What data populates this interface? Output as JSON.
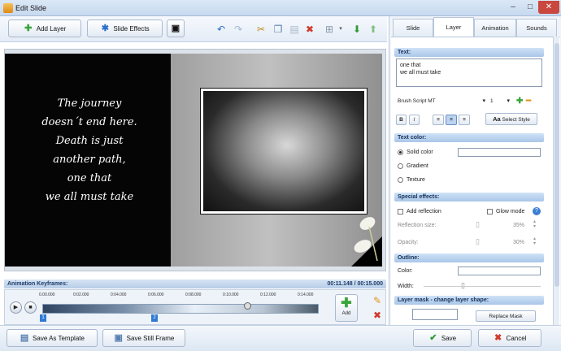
{
  "window": {
    "title": "Edit Slide",
    "controls": [
      "–",
      "□",
      "✕"
    ]
  },
  "toolbar": {
    "add_layer": "Add Layer",
    "slide_effects": "Slide Effects",
    "icons": [
      "preview-icon",
      "undo-icon",
      "redo-icon",
      "cut-icon",
      "copy-icon",
      "paste-icon",
      "delete-icon",
      "align-icon",
      "move-down-icon",
      "move-up-icon"
    ]
  },
  "canvas": {
    "verse_lines": [
      "The journey",
      "doesn´t end here.",
      "Death is just",
      "another path,",
      "one that",
      "we all must take"
    ]
  },
  "keyframes": {
    "label": "Animation Keyframes:",
    "time": "00:11.148 / 00:15.000",
    "ticks": [
      "0.00.000",
      "0:02.000",
      "0:04.000",
      "0:06.000",
      "0:08.000",
      "0:10.000",
      "0:12.000",
      "0:14.000"
    ],
    "markers": [
      "1",
      "2"
    ],
    "position_fraction": 0.74,
    "add_label": "Add"
  },
  "bottom": {
    "save_template": "Save As Template",
    "save_still": "Save Still Frame",
    "save": "Save",
    "cancel": "Cancel"
  },
  "panel": {
    "tabs": [
      "Slide",
      "Layer",
      "Animation",
      "Sounds"
    ],
    "active_tab": "Layer",
    "text_header": "Text:",
    "text_value_line1": "one that",
    "text_value_line2": "we all must take",
    "font_name": "Brush Script MT",
    "font_size": "1",
    "bold": "B",
    "italic": "I",
    "select_style": "Select Style",
    "text_color_header": "Text color:",
    "solid_color": "Solid color",
    "gradient": "Gradient",
    "texture": "Texture",
    "special_header": "Special effects:",
    "add_reflection": "Add reflection",
    "glow_mode": "Glow mode",
    "reflection_size": "Reflection size:",
    "reflection_size_value": "35%",
    "opacity": "Opacity:",
    "opacity_value": "30%",
    "outline_header": "Outline:",
    "color": "Color:",
    "width": "Width:",
    "mask_header": "Layer mask - change layer shape:",
    "replace_mask": "Replace Mask"
  }
}
